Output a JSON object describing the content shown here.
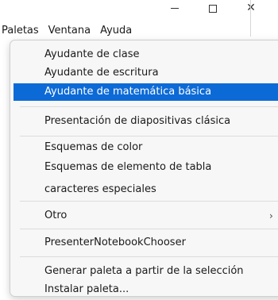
{
  "window_controls": {
    "minimize_glyph": "—",
    "close_glyph": "✕"
  },
  "menubar": {
    "items": [
      "Paletas",
      "Ventana",
      "Ayuda"
    ]
  },
  "dropdown": {
    "items": [
      "Ayudante de clase",
      "Ayudante de escritura",
      "Ayudante de matemática básica",
      "Presentación de diapositivas clásica",
      "Esquemas de color",
      "Esquemas de elemento de tabla",
      "caracteres especiales",
      "Otro",
      "PresenterNotebookChooser",
      "Generar paleta a partir de la selección",
      "Instalar paleta..."
    ],
    "submenu_arrow": "›",
    "highlight_color": "#0c6ad6"
  }
}
